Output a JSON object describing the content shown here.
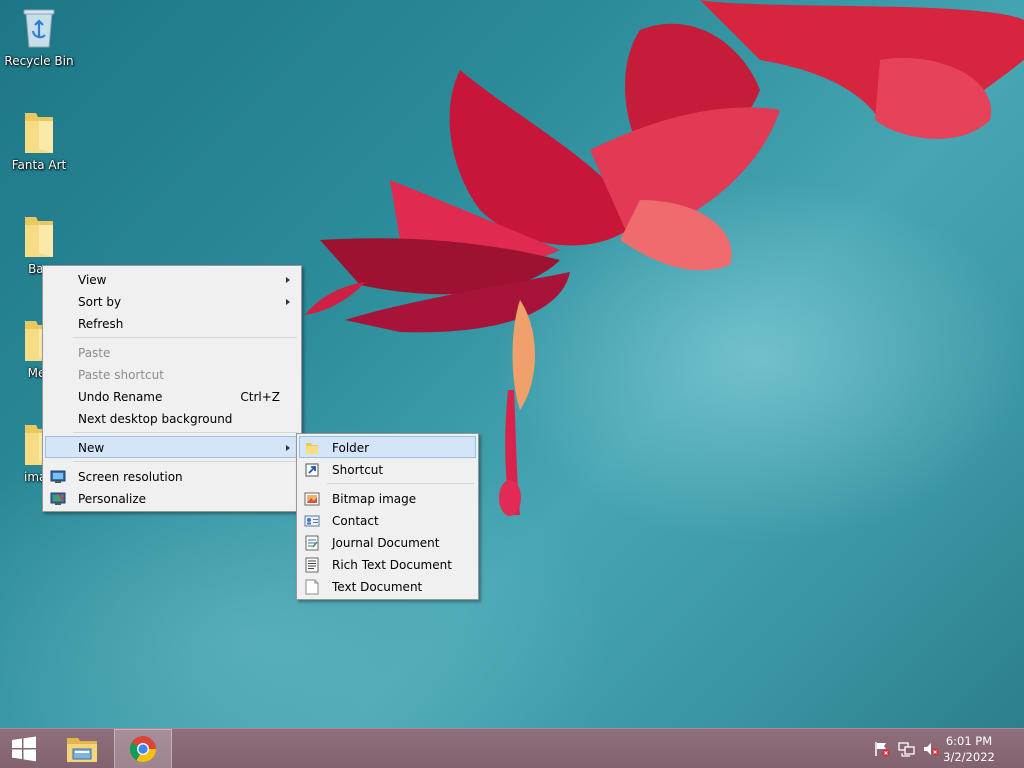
{
  "desktop": {
    "icons": [
      {
        "label": "Recycle Bin",
        "icon": "recycle-bin-icon"
      },
      {
        "label": "Fanta Art",
        "icon": "folder-icon"
      },
      {
        "label": "Bas",
        "icon": "folder-icon"
      },
      {
        "label": "Mer",
        "icon": "folder-icon"
      },
      {
        "label": "imag",
        "icon": "folder-icon"
      }
    ]
  },
  "context_menu": {
    "items": {
      "view": "View",
      "sort_by": "Sort by",
      "refresh": "Refresh",
      "paste": "Paste",
      "paste_shortcut": "Paste shortcut",
      "undo_rename": "Undo Rename",
      "undo_rename_shortcut": "Ctrl+Z",
      "next_background": "Next desktop background",
      "new": "New",
      "screen_resolution": "Screen resolution",
      "personalize": "Personalize"
    }
  },
  "new_submenu": {
    "items": {
      "folder": "Folder",
      "shortcut": "Shortcut",
      "bitmap": "Bitmap image",
      "contact": "Contact",
      "journal": "Journal Document",
      "rich_text": "Rich Text Document",
      "text": "Text Document"
    }
  },
  "taskbar": {
    "pinned": [
      {
        "icon": "start-windows-icon"
      },
      {
        "icon": "file-explorer-icon"
      },
      {
        "icon": "chrome-icon",
        "active": true
      }
    ],
    "tray": {
      "icons": [
        "action-center-flag-icon",
        "network-icon",
        "volume-muted-icon"
      ],
      "time": "6:01 PM",
      "date": "3/2/2022"
    }
  },
  "colors": {
    "taskbar": "#836270",
    "menu_bg": "#f0f0f0",
    "menu_highlight": "#d5e5f8",
    "wallpaper": "#2c8c9a"
  }
}
